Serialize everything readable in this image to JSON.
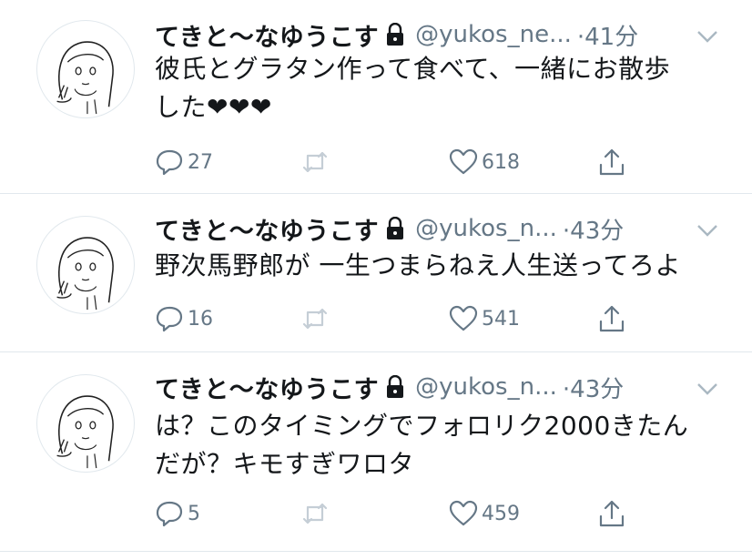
{
  "tweets": [
    {
      "name": "てきと〜なゆうこす",
      "handle": "@yukos_ne...",
      "time": "·41分",
      "text_lines": [
        "彼氏とグラタン作って食べて、一緒にお散歩",
        "した❤❤❤"
      ],
      "reply_count": "27",
      "retweet_count": "",
      "like_count": "618"
    },
    {
      "name": "てきと〜なゆうこす",
      "handle": "@yukos_n...",
      "time": "·43分",
      "text_lines": [
        "野次馬野郎が 一生つまらねえ人生送ってろよ"
      ],
      "reply_count": "16",
      "retweet_count": "",
      "like_count": "541"
    },
    {
      "name": "てきと〜なゆうこす",
      "handle": "@yukos_n...",
      "time": "·43分",
      "text_lines": [
        "は？このタイミングでフォロリク2000きたん",
        "だが？キモすぎワロタ"
      ],
      "reply_count": "5",
      "retweet_count": "",
      "like_count": "459"
    }
  ],
  "icons": {
    "lock": "lock-icon",
    "caret": "chevron-down-icon",
    "reply": "reply-icon",
    "retweet": "retweet-icon",
    "like": "heart-icon",
    "share": "share-icon"
  },
  "colors": {
    "text": "#14171a",
    "secondary": "#657786",
    "divider": "#e1e8ed",
    "icon": "#657786"
  }
}
